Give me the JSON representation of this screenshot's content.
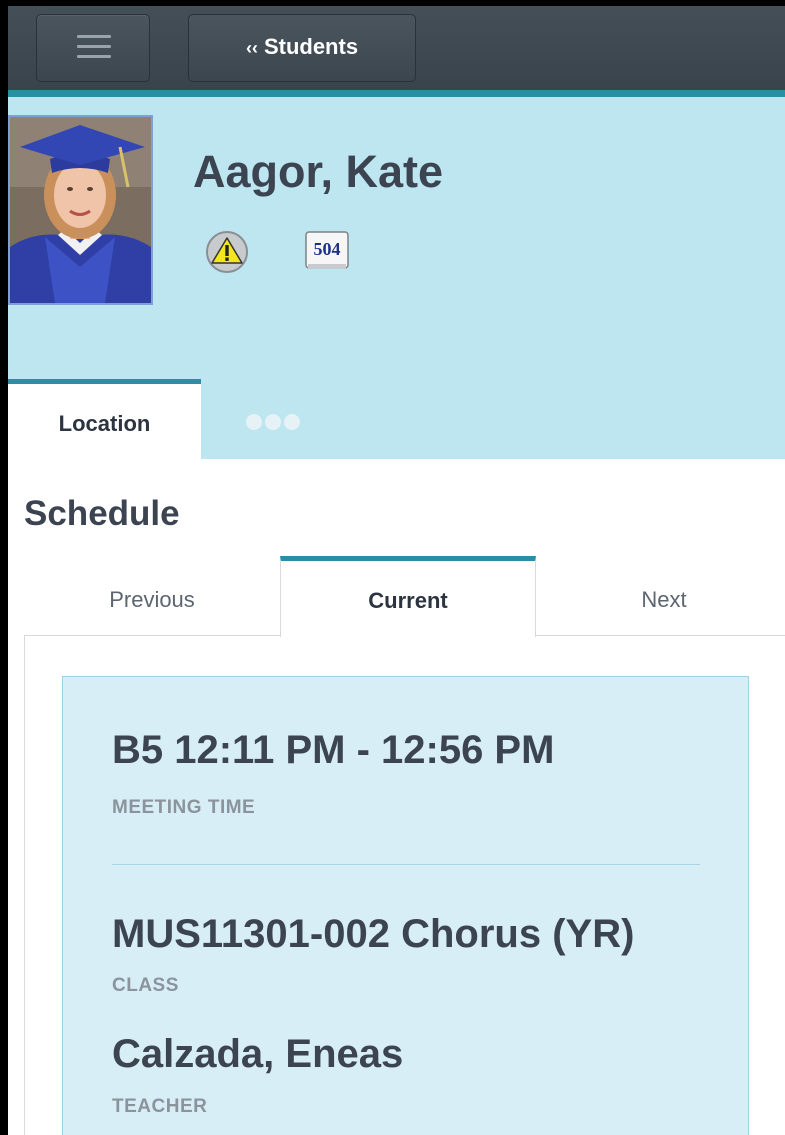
{
  "topbar": {
    "back_label": "Students",
    "back_chevron": "‹‹"
  },
  "student": {
    "name": "Aagor, Kate",
    "icons": [
      "alert-icon",
      "document-504-icon"
    ],
    "doc_badge": "504"
  },
  "tabs": {
    "items": [
      {
        "label": "Location",
        "active": true
      }
    ],
    "more": "more-dots-icon"
  },
  "schedule": {
    "title": "Schedule",
    "subtabs": {
      "previous": "Previous",
      "current": "Current",
      "next": "Next"
    },
    "entry": {
      "meeting_time": "B5 12:11 PM - 12:56 PM",
      "meeting_time_label": "MEETING TIME",
      "class": "MUS11301-002 Chorus (YR)",
      "class_label": "CLASS",
      "teacher": "Calzada, Eneas",
      "teacher_label": "TEACHER"
    }
  },
  "colors": {
    "topbar": "#3f4951",
    "accent": "#2a8fa3",
    "header_bg": "#bde6f0",
    "card_bg": "#d7eef6",
    "text": "#3b4450",
    "label": "#8b949c"
  }
}
